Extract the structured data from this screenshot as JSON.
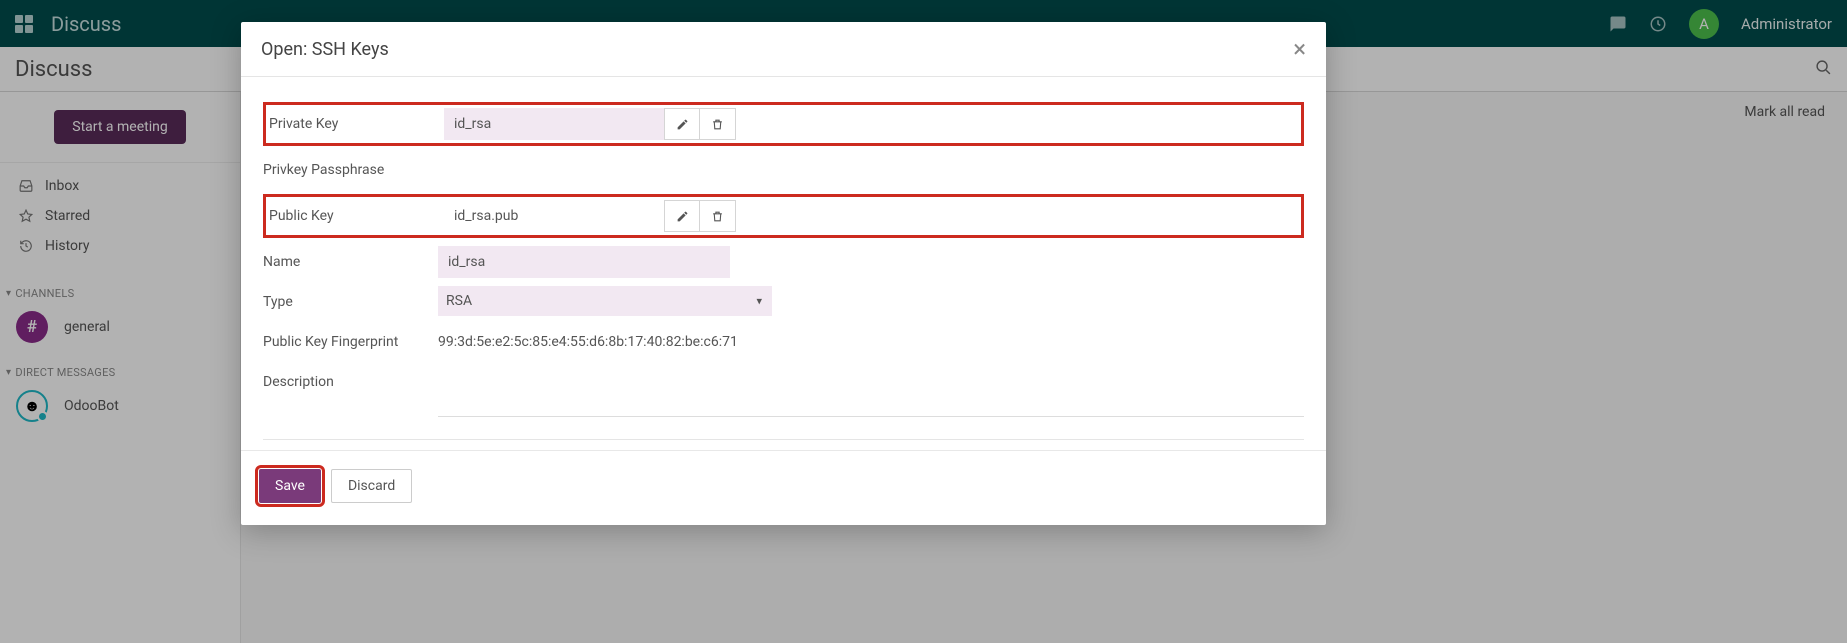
{
  "header": {
    "app_name": "Discuss",
    "user_initial": "A",
    "user_name": "Administrator"
  },
  "subheader": {
    "title": "Discuss"
  },
  "content": {
    "mark_all_read": "Mark all read"
  },
  "sidebar": {
    "start_meeting": "Start a meeting",
    "nav": {
      "inbox": "Inbox",
      "starred": "Starred",
      "history": "History"
    },
    "groups": {
      "channels": "CHANNELS",
      "direct_messages": "DIRECT MESSAGES"
    },
    "channel_hash": "#",
    "channel_general": "general",
    "dm_odoobot": "OdooBot"
  },
  "modal": {
    "title": "Open: SSH Keys",
    "labels": {
      "private_key": "Private Key",
      "privkey_passphrase": "Privkey Passphrase",
      "public_key": "Public Key",
      "name": "Name",
      "type": "Type",
      "fingerprint": "Public Key Fingerprint",
      "description": "Description"
    },
    "values": {
      "private_key_file": "id_rsa",
      "public_key_file": "id_rsa.pub",
      "name": "id_rsa",
      "type": "RSA",
      "fingerprint": "99:3d:5e:e2:5c:85:e4:55:d6:8b:17:40:82:be:c6:71"
    },
    "buttons": {
      "save": "Save",
      "discard": "Discard"
    }
  }
}
